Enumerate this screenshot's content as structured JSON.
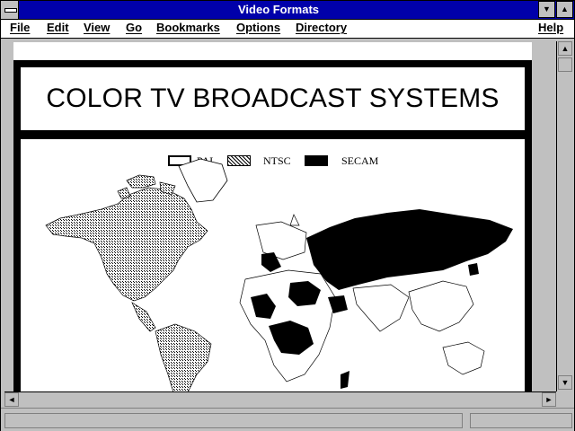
{
  "window": {
    "title": "Video Formats"
  },
  "menu": {
    "file": "File",
    "edit": "Edit",
    "view": "View",
    "go": "Go",
    "bookmarks": "Bookmarks",
    "options": "Options",
    "directory": "Directory",
    "help": "Help"
  },
  "page": {
    "title": "COLOR TV BROADCAST SYSTEMS",
    "legend": [
      {
        "label": "PAL",
        "fill": "white"
      },
      {
        "label": "NTSC",
        "fill": "crosshatch"
      },
      {
        "label": "SECAM",
        "fill": "black"
      }
    ]
  },
  "colors": {
    "titlebar": "#0000aa",
    "chrome": "#c0c0c0"
  },
  "icons": {
    "system_menu": "system-menu-icon",
    "minimize": "minimize-icon",
    "maximize": "maximize-icon",
    "up": "scroll-up-arrow-icon",
    "down": "scroll-down-arrow-icon",
    "left": "scroll-left-arrow-icon",
    "right": "scroll-right-arrow-icon"
  }
}
